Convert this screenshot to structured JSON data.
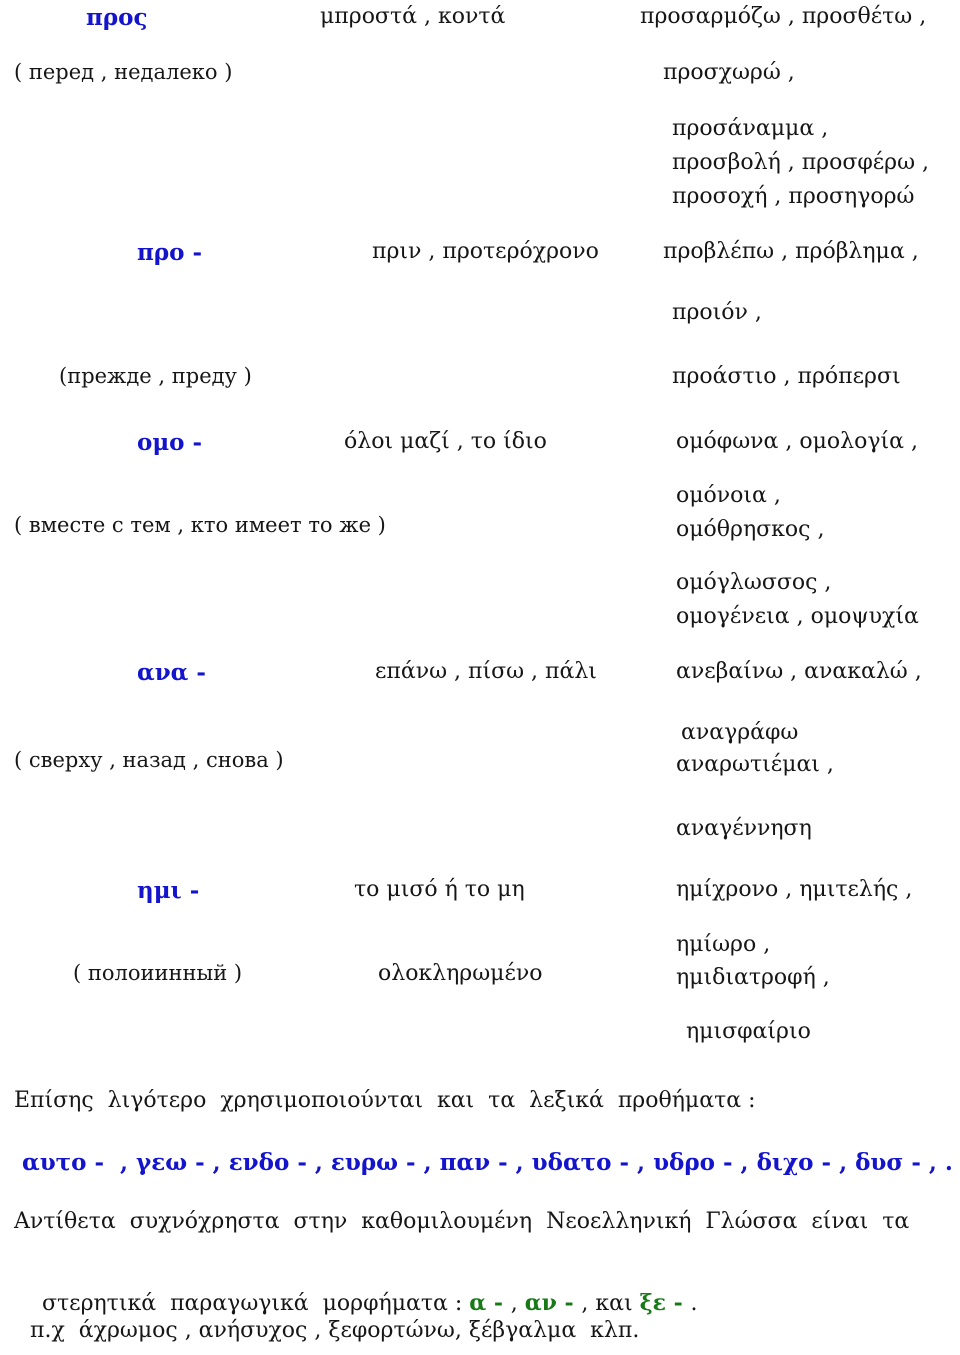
{
  "document": {
    "language": "Greek / Russian",
    "colors": {
      "prefix_blue": "#1414cc",
      "morpheme_green": "#177a17",
      "body_text": "#161616",
      "background": "#ffffff"
    },
    "entries": [
      {
        "prefix": "προς",
        "russian": "( перед , недалеко )",
        "meaning": "μπροστά , κοντά",
        "examples": [
          "προσαρμόζω , προσθέτω ,",
          "προσχωρώ ,",
          "προσάναμμα ,",
          "προσβολή , προσφέρω ,",
          "προσοχή , προσηγορώ"
        ]
      },
      {
        "prefix": "προ -",
        "russian": "(прежде , преду )",
        "meaning": "πριν , προτερόχρονο",
        "examples": [
          "προβλέπω , πρόβλημα ,",
          "προιόν ,",
          "προάστιο , πρόπερσι"
        ]
      },
      {
        "prefix": "ομο -",
        "russian": "( вместе с тем , кто имеет то же )",
        "meaning": "όλοι μαζί , το ίδιο",
        "examples": [
          "ομόφωνα , ομολογία ,",
          "ομόνοια ,",
          "ομόθρησκος ,",
          "ομόγλωσσος ,",
          "ομογένεια , ομοψυχία"
        ]
      },
      {
        "prefix": "ανα -",
        "russian": "( сверху , назад , снова )",
        "meaning": "επάνω , πίσω , πάλι",
        "examples": [
          "ανεβαίνω , ανακαλώ ,",
          "αναγράφω",
          "αναρωτιέμαι ,",
          "αναγέννηση"
        ]
      },
      {
        "prefix": "ημι -",
        "russian": "( полоиинный )",
        "meaning": "το μισό ή το μη",
        "meaning_second": "ολοκληρωμένο",
        "examples": [
          "ημίχρονο , ημιτελής ,",
          "ημίωρο ,",
          "ημιδιατροφή ,",
          "ημισφαίριο"
        ]
      }
    ],
    "footer": {
      "line1": "Επίσης  λιγότερο  χρησιμοποιούνται  και  τα  λεξικά  προθήματα :",
      "lexical_prefixes": "αυτο -  , γεω - , ενδο - , ευρω - , παν - , υδατο - , υδρο - , διχο - , δυσ - , .",
      "line2": "Αντίθετα  συχνόχρηστα  στην  καθομιλουμένη  Νεοελληνική  Γλώσσα  είναι  τα",
      "line3_prefix": "στερητικά  παραγωγικά  μορφήματα :",
      "morpheme_1": "α - ",
      "morpheme_sep_1": ",",
      "morpheme_2": "αν - ",
      "morpheme_sep_2": ",",
      "morpheme_and": "και",
      "morpheme_3": "ξε - ",
      "morpheme_end": ".",
      "line4": "π.χ  άχρωμος , ανήσυχος , ξεφορτώνω, ξέβγαλμα  κλπ."
    }
  }
}
